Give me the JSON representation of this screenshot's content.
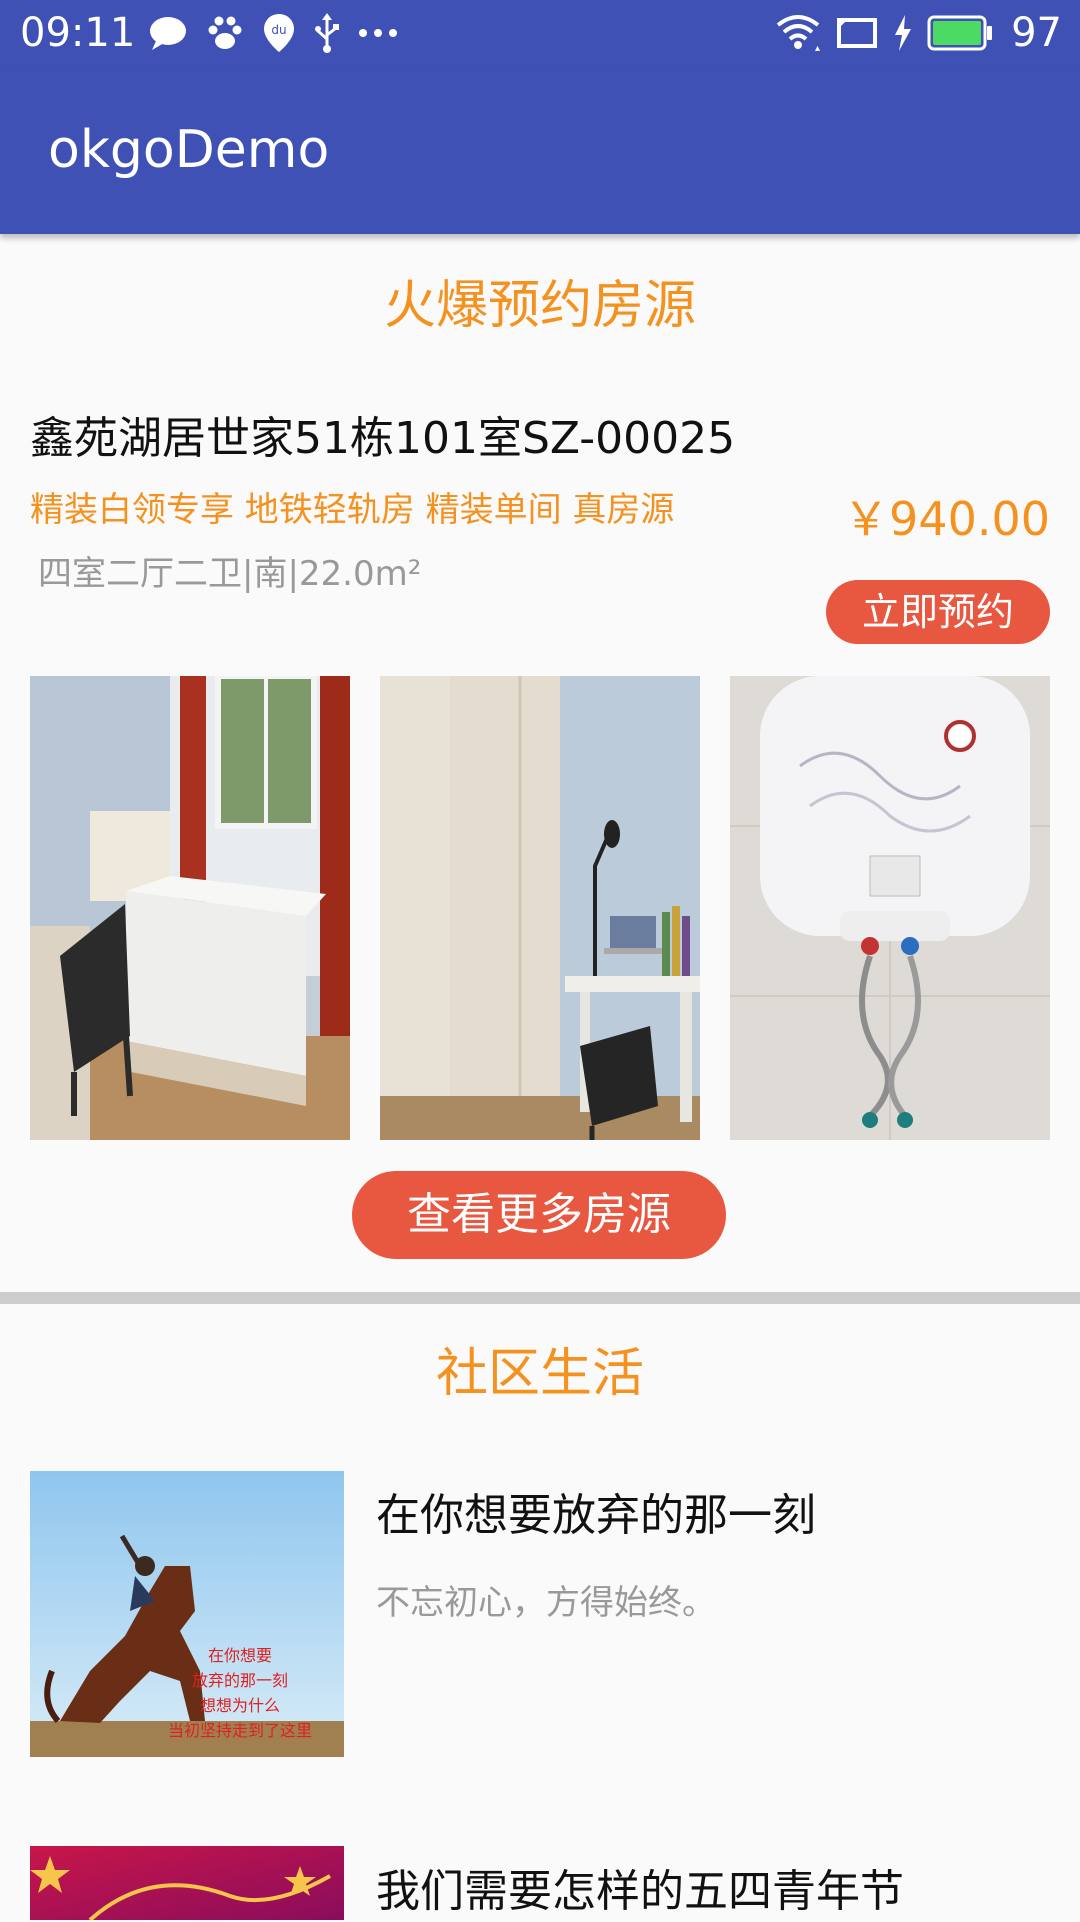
{
  "status_bar": {
    "time": "09:11",
    "battery_level": "97",
    "left_icons": [
      "chat-bubble-icon",
      "paw-icon",
      "du-location-icon",
      "usb-icon",
      "more-dots-icon"
    ],
    "right_icons": [
      "wifi-icon",
      "screen-cast-icon",
      "charging-icon",
      "battery-icon"
    ]
  },
  "app_bar": {
    "title": "okgoDemo"
  },
  "hot_section": {
    "title": "火爆预约房源",
    "listing": {
      "name": "鑫苑湖居世家51栋101室SZ-00025",
      "tags": "精装白领专享 地铁轻轨房 精装单间 真房源",
      "info": "四室二厅二卫|南|22.0m²",
      "price": "￥940.00",
      "book_label": "立即预约",
      "photos": [
        "bedroom-photo",
        "desk-wardrobe-photo",
        "water-heater-photo"
      ]
    },
    "more_label": "查看更多房源"
  },
  "community_section": {
    "title": "社区生活",
    "articles": [
      {
        "title": "在你想要放弃的那一刻",
        "summary": "不忘初心，方得始终。",
        "thumb_lines": [
          "在你想要",
          "放弃的那一刻",
          "想想为什么",
          "当初坚持走到了这里"
        ]
      },
      {
        "title": "我们需要怎样的五四青年节",
        "summary": ""
      }
    ]
  },
  "colors": {
    "primary": "#3f51b5",
    "accent_orange": "#f5911f",
    "button_red": "#e8573f"
  }
}
